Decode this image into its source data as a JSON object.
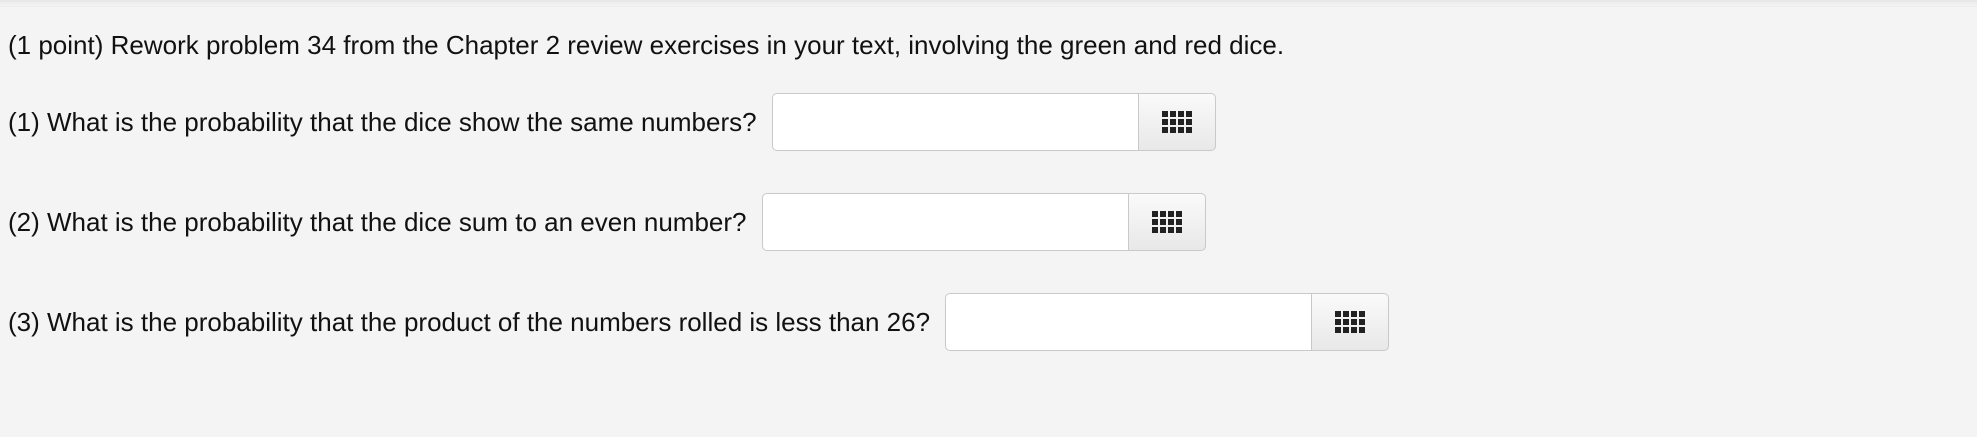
{
  "problem": {
    "intro": "(1 point) Rework problem 34 from the Chapter 2 review exercises in your text, involving the green and red dice.",
    "questions": [
      {
        "label": "(1) What is the probability that the dice show the same numbers?",
        "value": "",
        "palette_icon": "grid-icon"
      },
      {
        "label": "(2) What is the probability that the dice sum to an even number?",
        "value": "",
        "palette_icon": "grid-icon"
      },
      {
        "label": "(3) What is the probability that the product of the numbers rolled is less than 26?",
        "value": "",
        "palette_icon": "grid-icon"
      }
    ]
  }
}
